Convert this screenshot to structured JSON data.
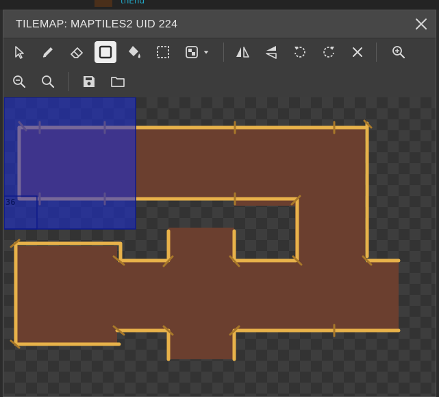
{
  "background": {
    "snippet_text": "thEnd"
  },
  "dialog": {
    "title": "TILEMAP: MAPTILES2 UID 224",
    "close_icon": "close-icon"
  },
  "toolbar": {
    "row1": [
      {
        "name": "select-tool",
        "icon": "cursor-icon"
      },
      {
        "name": "draw-tool",
        "icon": "pencil-icon"
      },
      {
        "name": "erase-tool",
        "icon": "eraser-icon"
      },
      {
        "name": "rectangle-tool",
        "icon": "rectangle-icon",
        "active": true
      },
      {
        "name": "fill-tool",
        "icon": "paint-bucket-icon"
      },
      {
        "name": "marquee-tool",
        "icon": "marquee-icon"
      },
      {
        "name": "autotile-tool",
        "icon": "autotile-icon",
        "dropdown": true
      },
      {
        "name": "flip-horizontal-tool",
        "icon": "flip-horizontal-icon"
      },
      {
        "name": "flip-vertical-tool",
        "icon": "flip-vertical-icon"
      },
      {
        "name": "rotate-left-tool",
        "icon": "rotate-left-icon"
      },
      {
        "name": "rotate-right-tool",
        "icon": "rotate-right-icon"
      },
      {
        "name": "clear-tool",
        "icon": "x-icon"
      },
      {
        "name": "zoom-in-tool",
        "icon": "zoom-in-icon"
      }
    ],
    "row2": [
      {
        "name": "zoom-out-tool",
        "icon": "zoom-out-icon"
      },
      {
        "name": "zoom-reset-tool",
        "icon": "magnifier-icon"
      },
      {
        "name": "save-tool",
        "icon": "save-icon"
      },
      {
        "name": "open-tool",
        "icon": "folder-icon"
      }
    ]
  },
  "tileset": {
    "selected_tile_label": "36",
    "selection_color": "#1a2bd8"
  },
  "colors": {
    "floor": "#6b3f2f",
    "wall": "#e8b24a",
    "wall_dark": "#a8782a",
    "accent_title": "#e6e6e6"
  }
}
